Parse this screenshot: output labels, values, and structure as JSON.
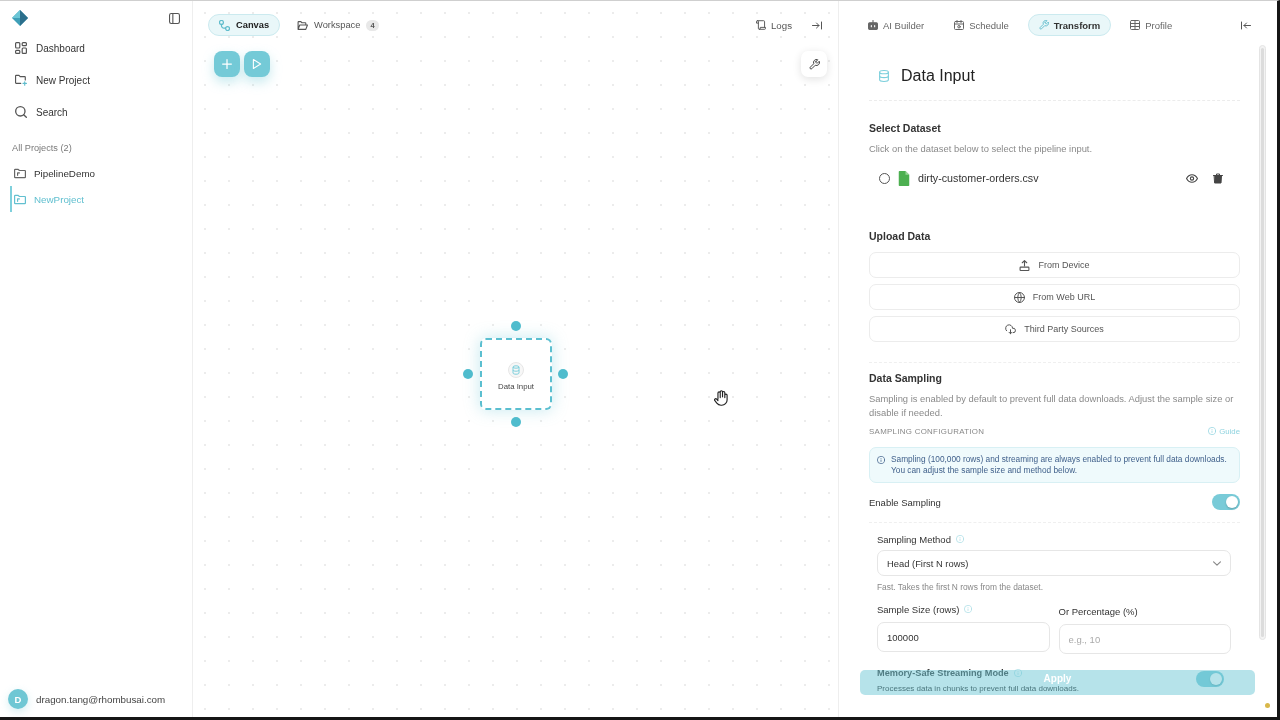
{
  "sidebar": {
    "nav": [
      {
        "label": "Dashboard"
      },
      {
        "label": "New Project"
      },
      {
        "label": "Search"
      }
    ],
    "projects_heading": "All Projects (2)",
    "projects": [
      {
        "label": "PipelineDemo",
        "selected": false
      },
      {
        "label": "NewProject",
        "selected": true
      }
    ],
    "user": {
      "initial": "D",
      "email": "dragon.tang@rhombusai.com"
    }
  },
  "canvas": {
    "tabs": [
      {
        "label": "Canvas",
        "selected": true
      },
      {
        "label": "Workspace",
        "selected": false,
        "badge": "4"
      }
    ],
    "logs": "Logs",
    "node": {
      "label": "Data Input",
      "selected": true
    }
  },
  "panel": {
    "tabs": [
      {
        "label": "AI Builder",
        "selected": false
      },
      {
        "label": "Schedule",
        "selected": false
      },
      {
        "label": "Transform",
        "selected": true
      },
      {
        "label": "Profile",
        "selected": false
      }
    ],
    "title": "Data Input",
    "select_dataset": {
      "heading": "Select Dataset",
      "description": "Click on the dataset below to select the pipeline input.",
      "datasets": [
        {
          "name": "dirty-customer-orders.csv",
          "selected": false
        }
      ]
    },
    "upload": {
      "heading": "Upload Data",
      "buttons": [
        "From Device",
        "From Web URL",
        "Third Party Sources"
      ]
    },
    "sampling": {
      "heading": "Data Sampling",
      "description": "Sampling is enabled by default to prevent full data downloads. Adjust the sample size or disable if needed.",
      "config_label": "SAMPLING CONFIGURATION",
      "guide_link": "Guide",
      "info": "Sampling (100,000 rows) and streaming are always enabled to prevent full data downloads. You can adjust the sample size and method below.",
      "enable": {
        "label": "Enable Sampling",
        "on": true
      },
      "method": {
        "label": "Sampling Method",
        "value": "Head (First N rows)",
        "hint": "Fast. Takes the first N rows from the dataset."
      },
      "size": {
        "label": "Sample Size (rows)",
        "value": "100000"
      },
      "percentage": {
        "label": "Or Percentage (%)",
        "placeholder": "e.g., 10"
      },
      "streaming": {
        "label": "Memory-Safe Streaming Mode",
        "description": "Processes data in chunks to prevent full data downloads.",
        "on": true
      }
    },
    "apply_button": "Apply"
  }
}
